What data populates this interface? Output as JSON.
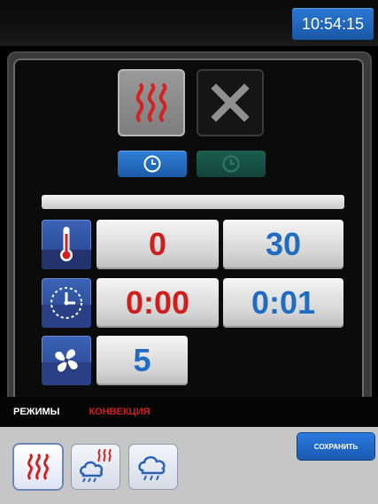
{
  "header": {
    "time": "10:54:15"
  },
  "controls": {
    "progress": 1.0,
    "temperature": {
      "current": "0",
      "target": "30"
    },
    "time": {
      "elapsed": "0:00",
      "target": "0:01"
    },
    "fan": {
      "speed": "5"
    }
  },
  "mode": {
    "label": "РЕЖИМЫ",
    "value": "КОНВЕКЦИЯ"
  },
  "footer": {
    "save_label": "СОХРАНИТЬ"
  },
  "icons": {
    "heat": "heat-waves-icon",
    "cancel": "close-icon",
    "timer_on": "clock-icon",
    "timer_off": "clock-icon",
    "thermometer": "thermometer-icon",
    "timer": "timer-dial-icon",
    "fan": "fan-icon",
    "convection": "heat-waves-icon",
    "combi": "combi-steam-heat-icon",
    "steam": "steam-icon"
  },
  "colors": {
    "accent_blue": "#1f6cc2",
    "accent_red": "#d01d1d",
    "tray": "#c6c6c6"
  }
}
